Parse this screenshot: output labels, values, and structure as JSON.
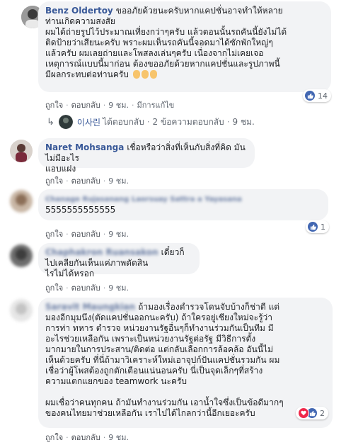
{
  "comments": [
    {
      "name": "Benz Oldertoy",
      "lines": [
        "ขออภัยด้วยนะครับหากแคปชั่นอาจทำให้หลาย",
        "ท่านเกิดความสงสัย",
        "ผมได้ถ่ายรูปไว้ประมาณเที่ยงกว่าๆครับ แล้วตอนนั้นรถคันนี้ยังไม่ได้",
        "ติดป้ายว่าเสียนะครับ พราะผมเห็นรถคันนี้จอดมาได้ซักพักใหญ่ๆ",
        "แล้วครับ ผมเลยถ่ายและโพสลงเล่นๆครับ เนื่องจากไม่เคยเจอ",
        "เหตุการณ์แบบนี้มาก่อน ต้องขออภัยด้วยหากแคปชั่นและรูปภาพนี้",
        "มีผลกระทบต่อท่านครับ"
      ],
      "like": "ถูกใจ",
      "reply": "ตอบกลับ",
      "time": "9 ชม.",
      "edited": "มีการแก้ไข",
      "reactions": "14",
      "reply_preview": {
        "arrow": "↳",
        "name": "이사린",
        "action": "ได้ตอบกลับ",
        "count": "2 ข้อความตอบกลับ",
        "time": "9 ชม."
      }
    },
    {
      "name": "Naret Mohsanga",
      "lines": [
        "เชื่อหรือว่าสิ่งที่เห็นกับสิ่งที่คิด มันไม่มีอะไร",
        "แอบแฝง"
      ],
      "like": "ถูกใจ",
      "reply": "ตอบกลับ",
      "time": "9 ชม."
    },
    {
      "name": "Chanage Rujasanang Laorsuay Sattra a Yayasana",
      "lines": [
        "5555555555555"
      ],
      "like": "ถูกใจ",
      "reply": "ตอบกลับ",
      "time": "9 ชม.",
      "reactions": "1"
    },
    {
      "name": "Chaphakron Ruansakon",
      "lines": [
        "เดี๋ยวก็ไปเคลียกันเห็นแค่ภาพตัดสิน",
        "ไรไม่ได้หรอก"
      ],
      "like": "ถูกใจ",
      "reply": "ตอบกลับ",
      "time": "9 ชม."
    },
    {
      "name": "Saravit Maungkian",
      "lines": [
        "ถ้ามองเรื่องตำรวจโดนจับบ้างก็ช่าตี แต่",
        "มองอีกมุมนึง(ตัดแคปชั่นออกนะครับ) ถ้าใครอยู่เชียงใหม่จะรู้ว่า",
        "การท่า ทหาร ตำรวจ หน่วยงานรัฐอื่นๆก็ทำงานร่วมกันเป็นทีม มี",
        "อะไรช่วยเหลือกัน เพราะเป็นหน่วยงานรัฐต่อรัฐ มีวิธีการตั้ง",
        "มากมายในการประสาน/ติดต่อ แต่กลับเลือกการล้อคล้อ อันนี้ไม่",
        "เห็นด้วยครับ ที่นี่ถ้ามาวิเคราะห์ใหม่เอาจุปก์ปันแคปชั่นรวมกัน ผม",
        "เชื่อว่าผู้โพสต้องถูกตักเตือนแน่นอนครับ นี่เป็นจุดเล็กๆที่สร้าง",
        "ความแตกแยกของ teamwork นะครับ",
        "",
        "ผมเชื่อว่าคนทุกคน ถ้ามันทำงานร่วมกัน เอาน้ำใจซึ่งเป็นข้อดีมากๆ",
        "ของคนไทยมาช่วยเหลือกัน เราไปได้ไกลกว่านี้อีกเยอะครับ"
      ],
      "like": "ถูกใจ",
      "reply": "ตอบกลับ",
      "time": "9 ชม.",
      "reactions": "2"
    }
  ],
  "colors": {
    "name": "#385898",
    "bubble": "#f2f3f5",
    "like_blue": "#4267b2",
    "heart_red": "#f0284a",
    "meta_gray": "#606770"
  }
}
